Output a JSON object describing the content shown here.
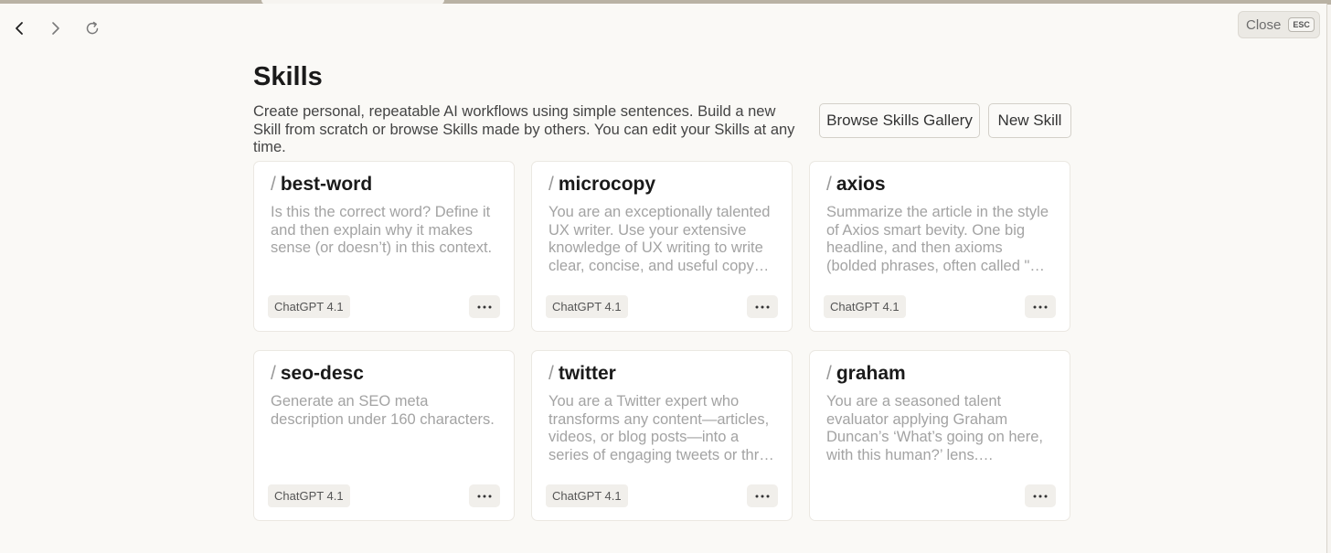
{
  "window": {
    "close_label": "Close",
    "close_key": "ESC"
  },
  "nav": {
    "back_icon": "chevron-left-icon",
    "forward_icon": "chevron-right-icon",
    "reload_icon": "reload-icon"
  },
  "header": {
    "title": "Skills",
    "subtitle": "Create personal, repeatable AI workflows using simple sentences. Build a new Skill from scratch or browse Skills made by others. You can edit your Skills at any time.",
    "browse_label": "Browse Skills Gallery",
    "new_label": "New Skill"
  },
  "skills": [
    {
      "slash": "/",
      "name": "best-word",
      "description": "Is this the correct word? Define it and then explain why it makes sense (or doesn’t) in this context.",
      "model": "ChatGPT 4.1"
    },
    {
      "slash": "/",
      "name": "microcopy",
      "description": "You are an exceptionally talented UX writer. Use your extensive knowledge of UX writing to write clear, concise, and useful copy…",
      "model": "ChatGPT 4.1"
    },
    {
      "slash": "/",
      "name": "axios",
      "description": "Summarize the article in the style of Axios smart bevity. One big headline, and then axioms (bolded phrases, often called \"…",
      "model": "ChatGPT 4.1"
    },
    {
      "slash": "/",
      "name": "seo-desc",
      "description": "Generate an SEO meta description under 160 characters.",
      "model": "ChatGPT 4.1"
    },
    {
      "slash": "/",
      "name": "twitter",
      "description": "You are a Twitter expert who transforms any content—articles, videos, or blog posts—into a series of engaging tweets or thr…",
      "model": "ChatGPT 4.1"
    },
    {
      "slash": "/",
      "name": "graham",
      "description": "You are a seasoned talent evaluator applying Graham Duncan’s ‘What’s going on here, with this human?’ lens.…",
      "model": ""
    }
  ]
}
